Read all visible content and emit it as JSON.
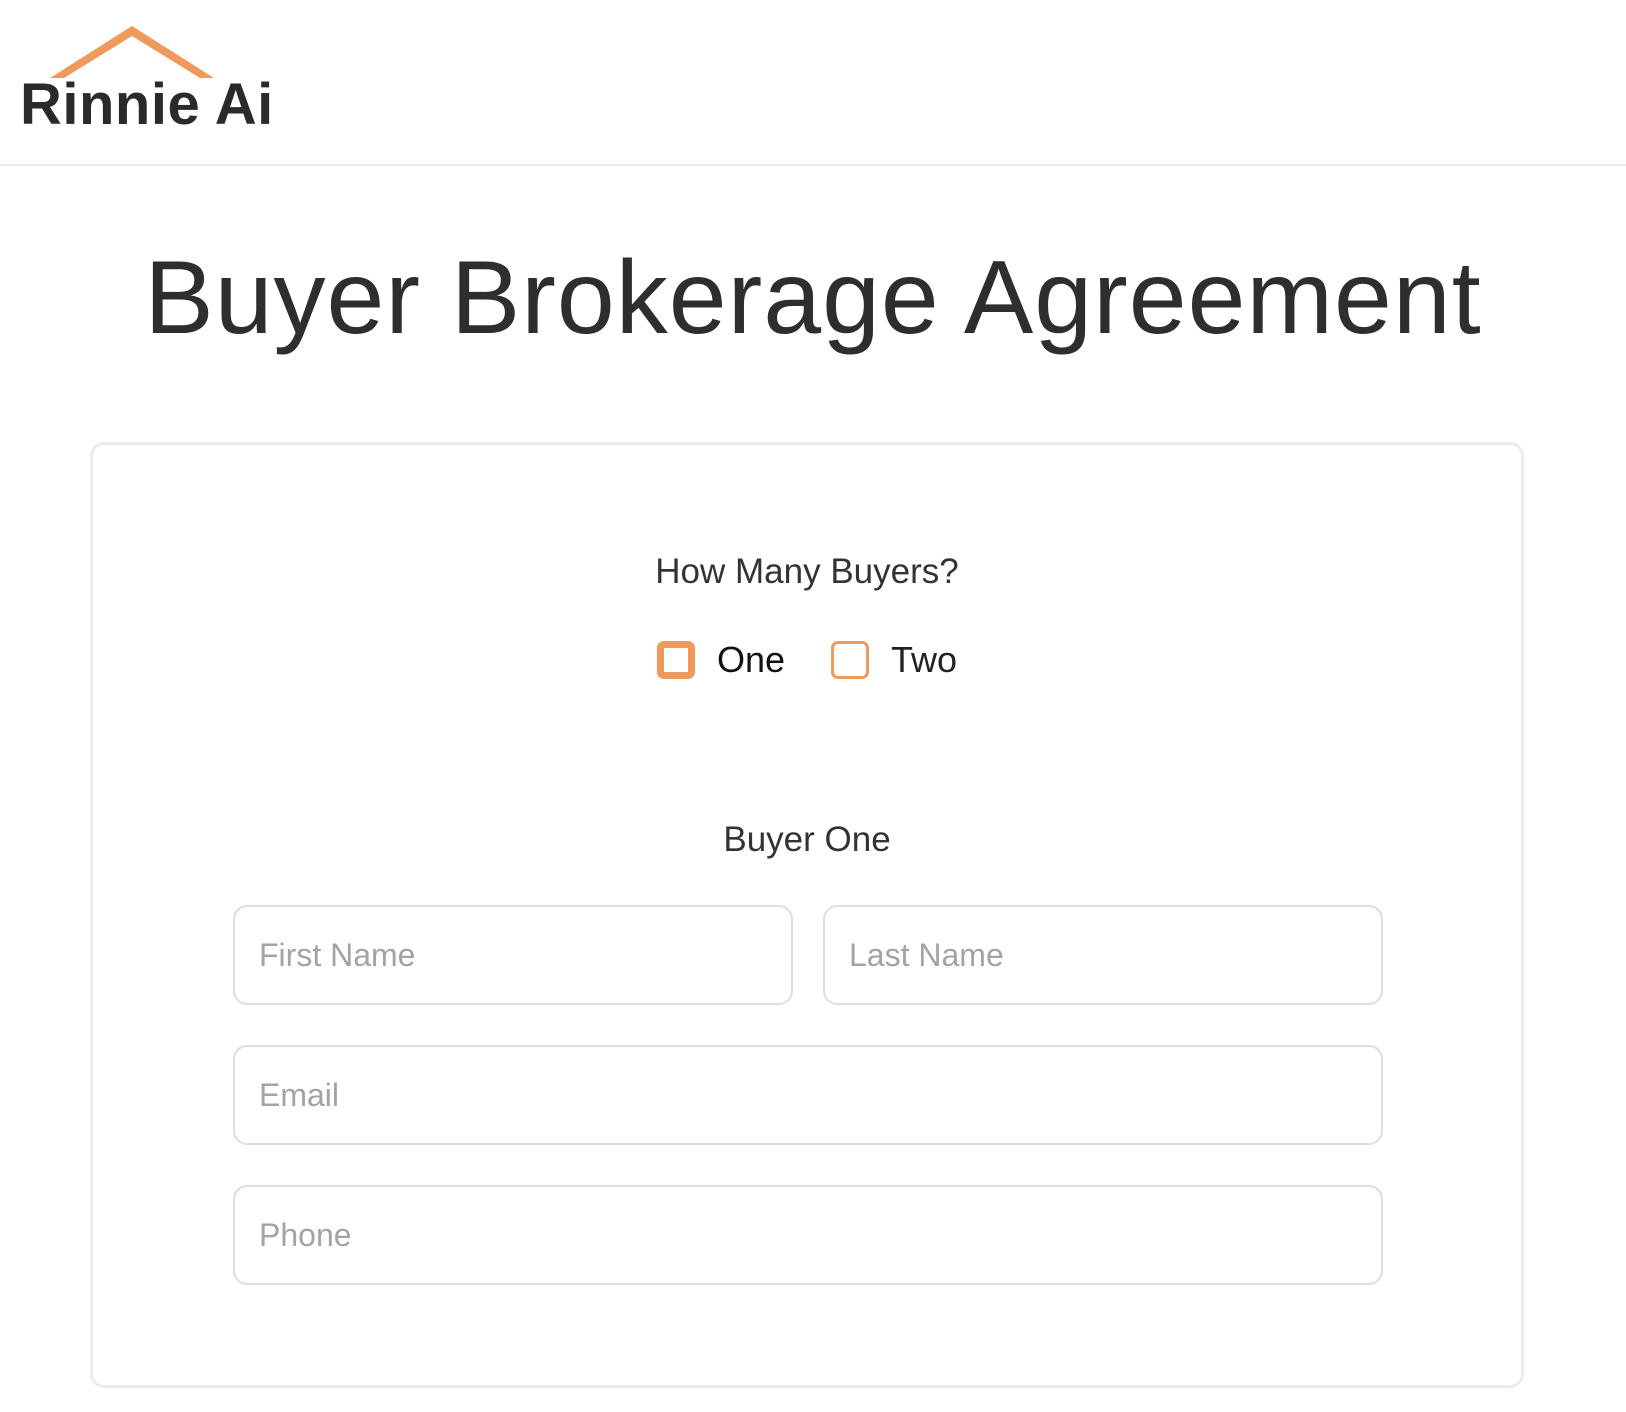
{
  "brand": {
    "name": "Rinnie Ai",
    "accent_color": "#ef9a5c",
    "logo_icon": "house-roof-icon"
  },
  "page": {
    "title": "Buyer Brokerage Agreement"
  },
  "form": {
    "question": "How Many Buyers?",
    "options": [
      {
        "label": "One",
        "checked": true
      },
      {
        "label": "Two",
        "checked": false
      }
    ],
    "section_title": "Buyer One",
    "fields": {
      "first_name": {
        "placeholder": "First Name",
        "value": ""
      },
      "last_name": {
        "placeholder": "Last Name",
        "value": ""
      },
      "email": {
        "placeholder": "Email",
        "value": ""
      },
      "phone": {
        "placeholder": "Phone",
        "value": ""
      }
    }
  }
}
